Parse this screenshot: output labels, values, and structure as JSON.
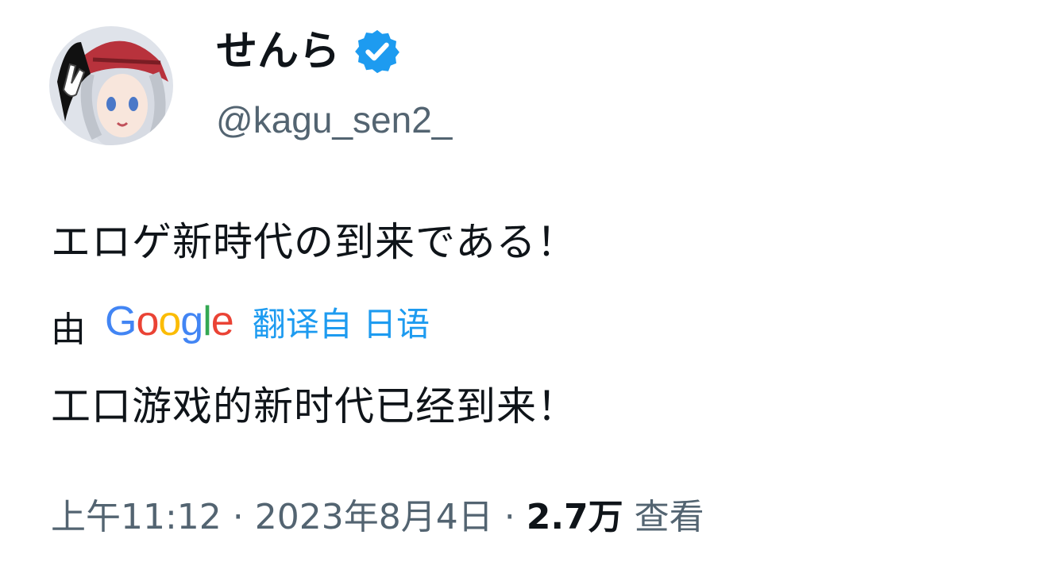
{
  "profile": {
    "display_name": "せんら",
    "handle": "@kagu_sen2_",
    "verified_icon": "verified-badge-icon",
    "avatar_icon": "anime-avatar"
  },
  "tweet": {
    "text": "エロゲ新時代の到来である！",
    "translate_by": "由",
    "google_logo_letters": [
      "G",
      "o",
      "o",
      "g",
      "l",
      "e"
    ],
    "translate_link": "翻译自 日语",
    "translated_text": "工口游戏的新时代已经到来！"
  },
  "meta": {
    "time": "上午11:12",
    "separator": " · ",
    "date": "2023年8月4日",
    "views_count": "2.7万",
    "views_label": " 查看"
  },
  "colors": {
    "verified": "#1d9bf0",
    "link": "#1d9bf0",
    "google_blue": "#4285f4",
    "google_red": "#ea4335",
    "google_yellow": "#fbbc05",
    "google_green": "#34a853"
  }
}
